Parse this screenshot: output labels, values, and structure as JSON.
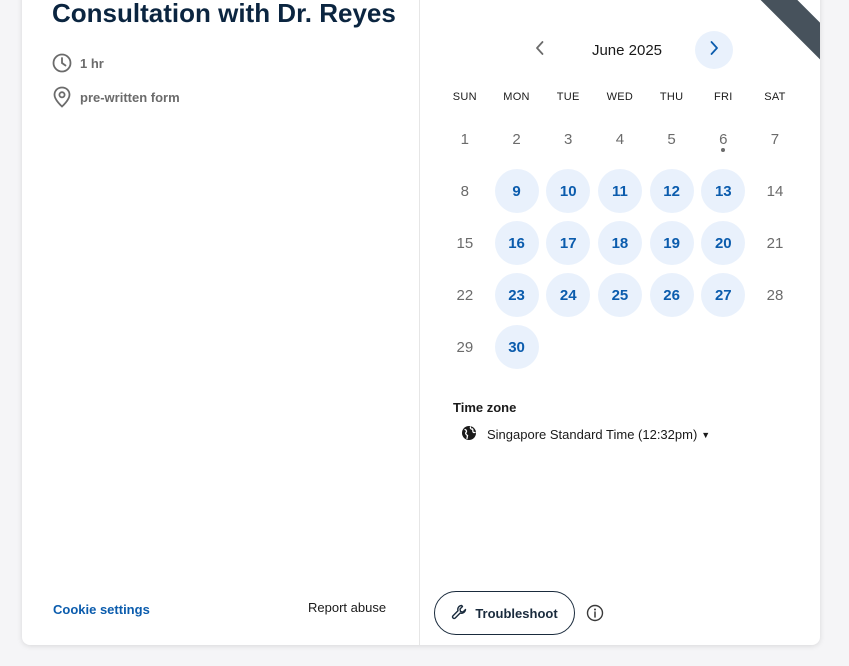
{
  "event": {
    "title": "Consultation with Dr. Reyes",
    "duration": "1 hr",
    "location": "pre-written form"
  },
  "footer": {
    "cookie_settings": "Cookie settings",
    "report_abuse": "Report abuse"
  },
  "calendar": {
    "month_label": "June 2025",
    "weekdays": [
      "SUN",
      "MON",
      "TUE",
      "WED",
      "THU",
      "FRI",
      "SAT"
    ],
    "days": [
      {
        "d": "1",
        "available": false
      },
      {
        "d": "2",
        "available": false
      },
      {
        "d": "3",
        "available": false
      },
      {
        "d": "4",
        "available": false
      },
      {
        "d": "5",
        "available": false
      },
      {
        "d": "6",
        "available": false,
        "today": true
      },
      {
        "d": "7",
        "available": false
      },
      {
        "d": "8",
        "available": false
      },
      {
        "d": "9",
        "available": true
      },
      {
        "d": "10",
        "available": true
      },
      {
        "d": "11",
        "available": true
      },
      {
        "d": "12",
        "available": true
      },
      {
        "d": "13",
        "available": true
      },
      {
        "d": "14",
        "available": false
      },
      {
        "d": "15",
        "available": false
      },
      {
        "d": "16",
        "available": true
      },
      {
        "d": "17",
        "available": true
      },
      {
        "d": "18",
        "available": true
      },
      {
        "d": "19",
        "available": true
      },
      {
        "d": "20",
        "available": true
      },
      {
        "d": "21",
        "available": false
      },
      {
        "d": "22",
        "available": false
      },
      {
        "d": "23",
        "available": true
      },
      {
        "d": "24",
        "available": true
      },
      {
        "d": "25",
        "available": true
      },
      {
        "d": "26",
        "available": true
      },
      {
        "d": "27",
        "available": true
      },
      {
        "d": "28",
        "available": false
      },
      {
        "d": "29",
        "available": false
      },
      {
        "d": "30",
        "available": true
      }
    ]
  },
  "timezone": {
    "label": "Time zone",
    "value": "Singapore Standard Time (12:32pm)"
  },
  "actions": {
    "troubleshoot": "Troubleshoot"
  },
  "icons": {
    "duration": "clock-icon",
    "location": "location-pin-icon",
    "prev": "chevron-left-icon",
    "next": "chevron-right-icon",
    "timezone": "globe-icon",
    "troubleshoot": "wrench-icon",
    "info": "info-icon"
  },
  "colors": {
    "accent": "#0b5cad",
    "available_bg": "#e9f1fc",
    "title": "#0b2540",
    "ribbon": "#47525c"
  }
}
